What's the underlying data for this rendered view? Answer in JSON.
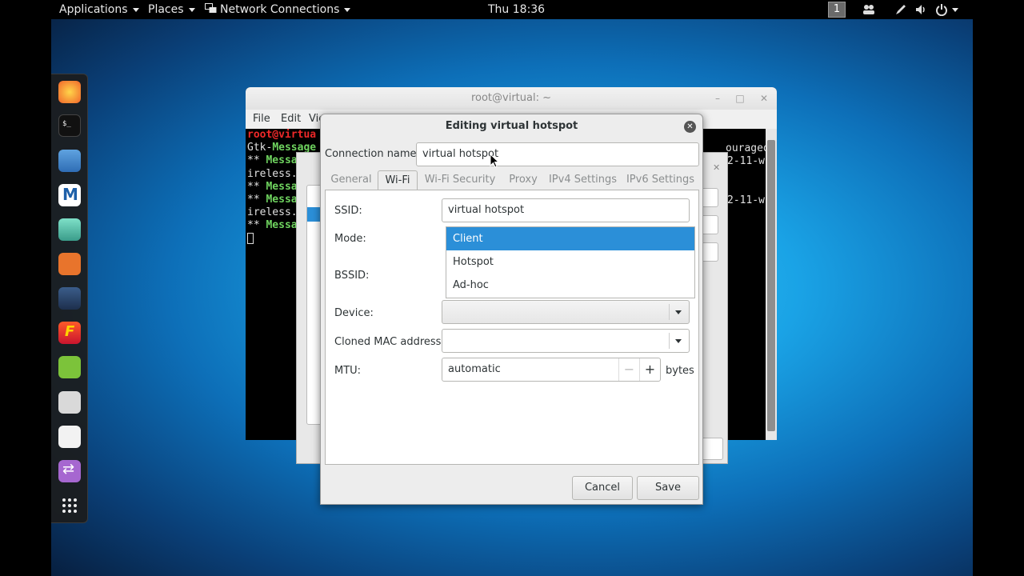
{
  "topbar": {
    "applications": "Applications",
    "places": "Places",
    "network_connections": "Network Connections",
    "clock": "Thu 18:36",
    "workspace": "1"
  },
  "dock": {
    "items": [
      "firefox-icon",
      "terminal-icon",
      "files-icon",
      "metasploit-icon",
      "armitage-icon",
      "burpsuite-icon",
      "maltego-icon",
      "faraday-icon",
      "leafpad-icon",
      "screenshot-icon",
      "tweak-icon",
      "switcher-icon",
      "show-apps-icon"
    ]
  },
  "terminal": {
    "title": "root@virtual: ~",
    "menu": [
      "File",
      "Edit",
      "Vie"
    ],
    "lines": [
      {
        "prefix": "root@virtua",
        "prefix_color": "red",
        "text": ""
      },
      {
        "prefix": "",
        "text": "Gtk-",
        "highlight": "Message"
      },
      {
        "prefix": "** ",
        "text": "",
        "highlight": "Messa"
      },
      {
        "prefix": "",
        "text": "ireless."
      },
      {
        "prefix": "** ",
        "text": "",
        "highlight": "Messa"
      },
      {
        "prefix": "** ",
        "text": "",
        "highlight": "Messa"
      },
      {
        "prefix": "",
        "text": "ireless."
      },
      {
        "prefix": "** ",
        "text": "",
        "highlight": "Messa"
      }
    ],
    "right_fragments": [
      "ouraged.",
      "2-11-w",
      "2-11-w"
    ]
  },
  "dialog": {
    "title": "Editing virtual hotspot",
    "connection_name_label": "Connection name:",
    "connection_name_value": "virtual hotspot",
    "tabs": [
      "General",
      "Wi-Fi",
      "Wi-Fi Security",
      "Proxy",
      "IPv4 Settings",
      "IPv6 Settings"
    ],
    "active_tab": "Wi-Fi",
    "ssid_label": "SSID:",
    "ssid_value": "virtual hotspot",
    "mode_label": "Mode:",
    "mode_options": [
      "Client",
      "Hotspot",
      "Ad-hoc"
    ],
    "mode_selected": "Client",
    "bssid_label": "BSSID:",
    "device_label": "Device:",
    "device_value": "",
    "cloned_mac_label": "Cloned MAC address:",
    "cloned_mac_value": "",
    "mtu_label": "MTU:",
    "mtu_value": "automatic",
    "mtu_unit": "bytes",
    "minus": "−",
    "plus": "+",
    "cancel": "Cancel",
    "save": "Save"
  }
}
